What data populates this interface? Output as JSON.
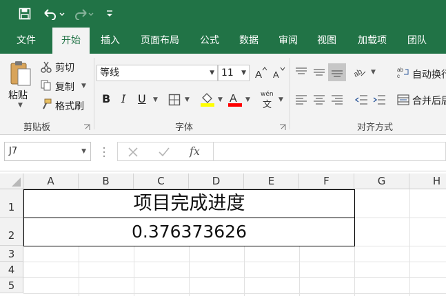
{
  "qat": {
    "save_icon": "save-icon",
    "undo_icon": "undo-icon",
    "redo_icon": "redo-icon",
    "customize_icon": "customize-qat-icon"
  },
  "tabs": [
    {
      "label": "文件"
    },
    {
      "label": "开始"
    },
    {
      "label": "插入"
    },
    {
      "label": "页面布局"
    },
    {
      "label": "公式"
    },
    {
      "label": "数据"
    },
    {
      "label": "审阅"
    },
    {
      "label": "视图"
    },
    {
      "label": "加载项"
    },
    {
      "label": "团队"
    }
  ],
  "clipboard": {
    "paste": "粘贴",
    "cut": "剪切",
    "copy": "复制",
    "format_painter": "格式刷",
    "group_label": "剪贴板"
  },
  "font": {
    "font_name": "等线",
    "font_size": "11",
    "bold": "B",
    "italic": "I",
    "underline": "U",
    "phonetic": "wén",
    "group_label": "字体",
    "highlight_color": "#FFFF00",
    "font_color": "#FF0000"
  },
  "alignment": {
    "wrap_text": "自动换行",
    "merge_center": "合并后居中",
    "group_label": "对齐方式"
  },
  "formula_bar": {
    "name_box": "J7",
    "fx": "fx",
    "formula": ""
  },
  "sheet": {
    "columns": [
      "A",
      "B",
      "C",
      "D",
      "E",
      "F",
      "G",
      "H"
    ],
    "rows": [
      "1",
      "2",
      "3",
      "4",
      "5"
    ],
    "cell_row1": "项目完成进度",
    "cell_row2": "0.376373626"
  },
  "colors": {
    "accent": "#217346",
    "ribbon_bg": "#F3F3F3"
  }
}
